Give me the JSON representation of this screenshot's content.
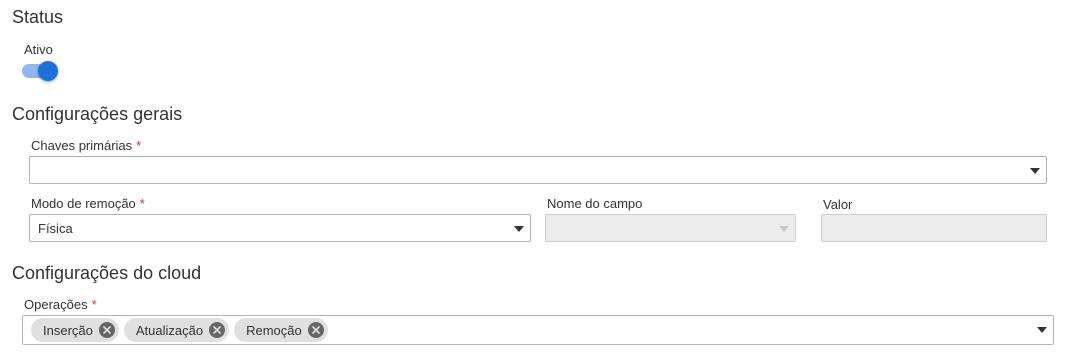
{
  "status": {
    "title": "Status",
    "toggle_label": "Ativo",
    "active": true
  },
  "general": {
    "title": "Configurações gerais",
    "primary_keys": {
      "label": "Chaves primárias",
      "required": "*",
      "value": ""
    },
    "removal_mode": {
      "label": "Modo de remoção",
      "required": "*",
      "value": "Física"
    },
    "field_name": {
      "label": "Nome do campo",
      "value": ""
    },
    "value_field": {
      "label": "Valor",
      "value": ""
    }
  },
  "cloud": {
    "title": "Configurações do cloud",
    "operations": {
      "label": "Operações",
      "required": "*",
      "chips": [
        "Inserção",
        "Atualização",
        "Remoção"
      ]
    }
  },
  "colors": {
    "accent": "#1e6fd9",
    "required": "#d32f2f",
    "chip_bg": "#e0e0e0"
  }
}
